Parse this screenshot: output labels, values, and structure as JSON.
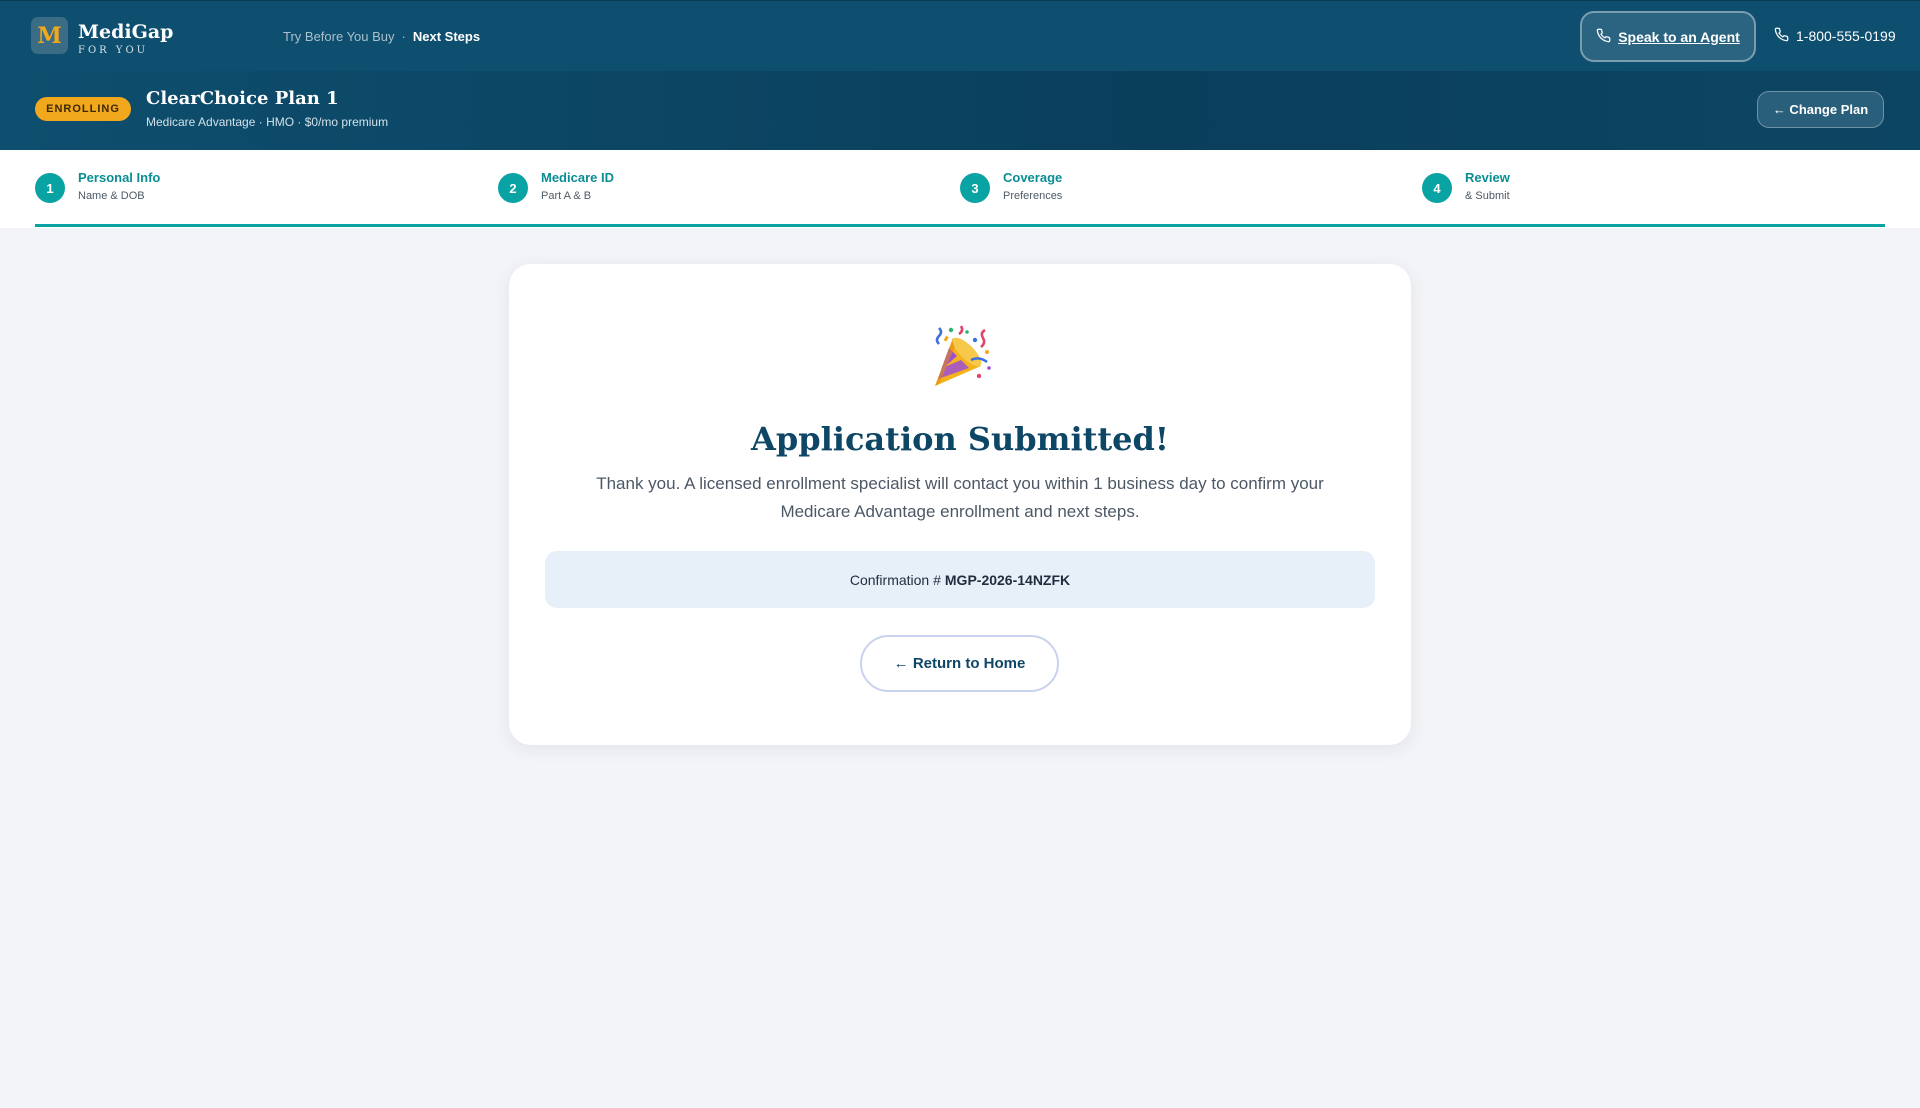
{
  "brand": {
    "logo_letter": "M",
    "name": "MediGap",
    "tagline": "FOR YOU"
  },
  "breadcrumb": {
    "items": [
      "Try Before You Buy",
      "Next Steps"
    ],
    "separator": "·"
  },
  "header": {
    "agent_button_label": "Speak to an Agent",
    "phone_number": "1-800-555-0199"
  },
  "plan": {
    "status_badge": "ENROLLING",
    "name": "ClearChoice Plan 1",
    "meta": "Medicare Advantage · HMO · $0/mo premium",
    "change_button_label": "← Change Plan"
  },
  "steps": [
    {
      "number": "1",
      "title": "Personal Info",
      "subtitle": "Name & DOB"
    },
    {
      "number": "2",
      "title": "Medicare ID",
      "subtitle": "Part A & B"
    },
    {
      "number": "3",
      "title": "Coverage",
      "subtitle": "Preferences"
    },
    {
      "number": "4",
      "title": "Review",
      "subtitle": "& Submit"
    }
  ],
  "progress_fraction": 1.0,
  "confirmation_card": {
    "icon": "party-popper-icon",
    "title": "Application Submitted!",
    "message": "Thank you. A licensed enrollment specialist will contact you within 1 business day to confirm your Medicare Advantage enrollment and next steps.",
    "confirmation_label": "Confirmation #",
    "confirmation_number": "MGP-2026-14NZFK",
    "return_button_label": "← Return to Home"
  },
  "colors": {
    "nav_bg": "#0e4e6e",
    "accent_teal": "#0aa3a3",
    "badge_gold": "#f2a81d",
    "title_navy": "#0e4666",
    "page_bg": "#f3f4f8"
  }
}
